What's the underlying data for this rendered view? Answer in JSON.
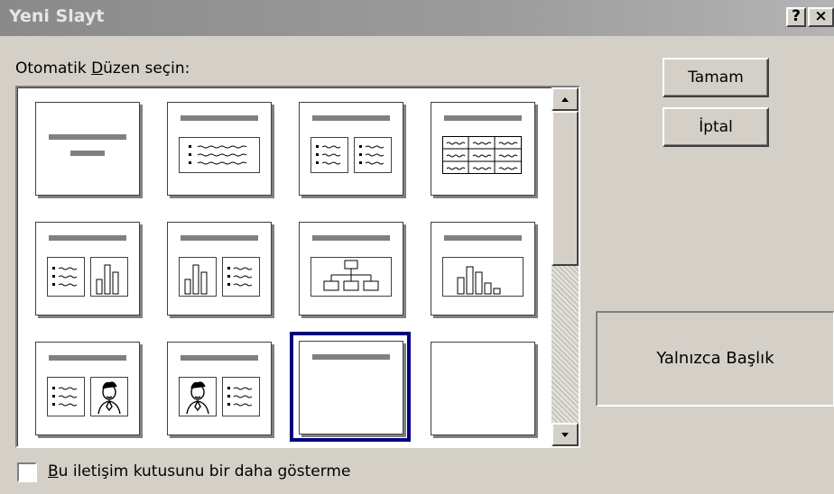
{
  "dialog": {
    "title": "Yeni Slayt",
    "help_label": "?",
    "close_label": "×"
  },
  "gallery": {
    "label_prefix": "Otomatik ",
    "label_underlined": "D",
    "label_suffix": "üzen seçin:",
    "selected_index": 10,
    "layouts": [
      {
        "icon": "title-slide-layout-icon"
      },
      {
        "icon": "bulleted-list-layout-icon"
      },
      {
        "icon": "two-column-text-layout-icon"
      },
      {
        "icon": "table-layout-icon"
      },
      {
        "icon": "text-and-chart-layout-icon"
      },
      {
        "icon": "chart-and-text-layout-icon"
      },
      {
        "icon": "organization-chart-layout-icon"
      },
      {
        "icon": "chart-layout-icon"
      },
      {
        "icon": "text-and-clip-art-layout-icon"
      },
      {
        "icon": "clip-art-and-text-layout-icon"
      },
      {
        "icon": "title-only-layout-icon"
      },
      {
        "icon": "blank-layout-icon"
      }
    ]
  },
  "buttons": {
    "ok": "Tamam",
    "cancel": "İptal"
  },
  "preview": {
    "caption": "Yalnızca Başlık"
  },
  "footer": {
    "checkbox_underlined": "B",
    "checkbox_rest": "u iletişim kutusunu bir daha gösterme",
    "checked": false
  },
  "colors": {
    "selection": "#00007f",
    "titlebar": "#8a8a8a",
    "dialog_bg": "#d4d0c8"
  }
}
